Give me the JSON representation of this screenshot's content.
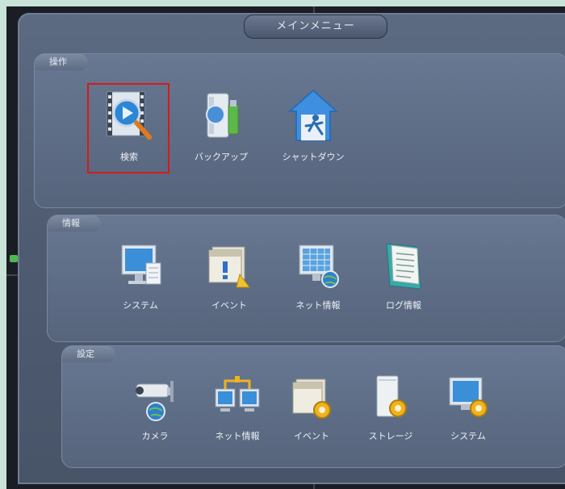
{
  "menu": {
    "title": "メインメニュー"
  },
  "sections": {
    "operation": {
      "label": "操作",
      "items": [
        {
          "label": "検索"
        },
        {
          "label": "バックアップ"
        },
        {
          "label": "シャットダウン"
        }
      ]
    },
    "info": {
      "label": "情報",
      "items": [
        {
          "label": "システム"
        },
        {
          "label": "イベント"
        },
        {
          "label": "ネット情報"
        },
        {
          "label": "ログ情報"
        }
      ]
    },
    "settings": {
      "label": "設定",
      "items": [
        {
          "label": "カメラ"
        },
        {
          "label": "ネット情報"
        },
        {
          "label": "イベント"
        },
        {
          "label": "ストレージ"
        },
        {
          "label": "システム"
        }
      ]
    }
  },
  "colors": {
    "highlight": "#d61a1a",
    "panel": "#5d6b82"
  }
}
